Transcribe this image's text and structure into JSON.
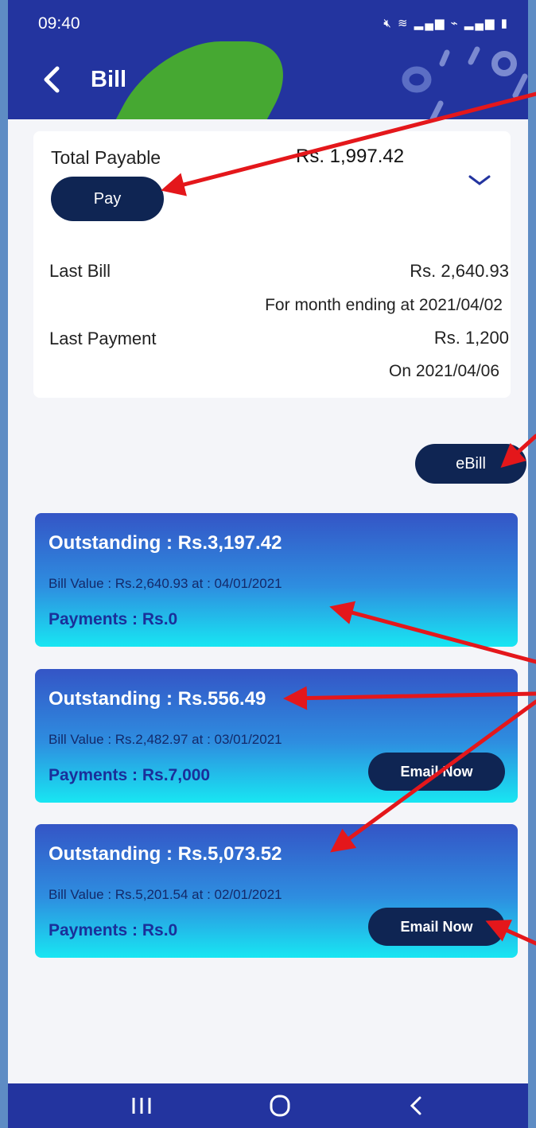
{
  "status_bar": {
    "time": "09:40",
    "icons": [
      "mute-icon",
      "wifi-icon",
      "signal-icon",
      "volte-icon",
      "signal-icon",
      "battery-icon"
    ]
  },
  "header": {
    "title": "Bill",
    "background": "#23349f",
    "accent_green": "#46a832"
  },
  "summary": {
    "total_label": "Total Payable",
    "total_value": "Rs. 1,997.42",
    "pay_label": "Pay",
    "last_bill_label": "Last Bill",
    "last_bill_value": "Rs. 2,640.93",
    "last_bill_note": "For month ending at 2021/04/02",
    "last_payment_label": "Last Payment",
    "last_payment_value": "Rs. 1,200",
    "last_payment_note": "On 2021/04/06"
  },
  "ebill_label": "eBill",
  "bills": [
    {
      "outstanding": "Outstanding : Rs.3,197.42",
      "bill_value": "Bill Value : Rs.2,640.93 at : 04/01/2021",
      "payments": "Payments : Rs.0",
      "email_label": ""
    },
    {
      "outstanding": "Outstanding : Rs.556.49",
      "bill_value": "Bill Value : Rs.2,482.97 at : 03/01/2021",
      "payments": "Payments : Rs.7,000",
      "email_label": "Email Now"
    },
    {
      "outstanding": "Outstanding : Rs.5,073.52",
      "bill_value": "Bill Value : Rs.5,201.54 at : 02/01/2021",
      "payments": "Payments : Rs.0",
      "email_label": "Email Now"
    }
  ],
  "nav": [
    "recents-icon",
    "home-icon",
    "back-icon"
  ],
  "colors": {
    "button_dark": "#0f2553",
    "annotation_red": "#e4171b"
  }
}
